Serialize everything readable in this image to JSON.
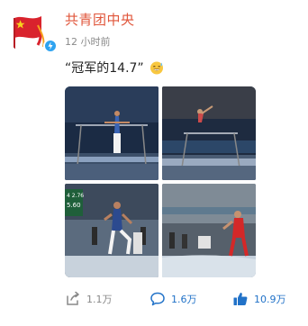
{
  "post": {
    "author": "共青团中央",
    "time": "12 小时前",
    "text": "“冠军的14.7”",
    "emoji": "sweat-smile-emoji"
  },
  "images": [
    {
      "name": "gymnastics-photo-1",
      "description_icon": "photo"
    },
    {
      "name": "gymnastics-photo-2",
      "description_icon": "photo"
    },
    {
      "name": "gymnastics-photo-3",
      "description_icon": "photo"
    },
    {
      "name": "gymnastics-photo-4",
      "description_icon": "photo"
    }
  ],
  "photo3_overlay": {
    "line1": "4 2.76",
    "line2": "5.60"
  },
  "actions": {
    "repost": "1.1万",
    "comment": "1.6万",
    "like": "10.9万"
  },
  "colors": {
    "author": "#e0553a",
    "accent": "#2172c8",
    "verified": "#2fa3f0"
  }
}
